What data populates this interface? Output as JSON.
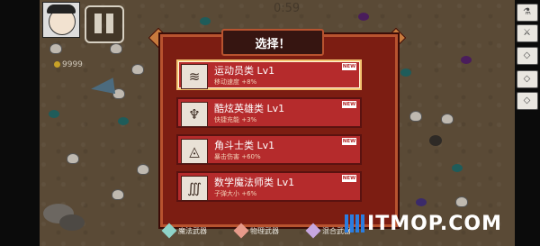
{
  "hud": {
    "timer": "0:59",
    "score": "9999",
    "pause_label": "pause"
  },
  "dialog": {
    "title": "选择！",
    "cards": [
      {
        "name": "运动员类 Lv1",
        "desc": "移动速度 +8%",
        "badge": "NEW",
        "icon": "runner-icon",
        "glyph": "≋"
      },
      {
        "name": "酷炫英雄类 Lv1",
        "desc": "快捷充能 +3%",
        "badge": "NEW",
        "icon": "hero-mask-icon",
        "glyph": "♆"
      },
      {
        "name": "角斗士类 Lv1",
        "desc": "暴击伤害 +60%",
        "badge": "NEW",
        "icon": "gladiator-helmet-icon",
        "glyph": "◬"
      },
      {
        "name": "数学魔法师类 Lv1",
        "desc": "子弹大小 +6%",
        "badge": "NEW",
        "icon": "math-wizard-icon",
        "glyph": "∭"
      }
    ]
  },
  "legend": [
    {
      "label": "魔法武器",
      "color": "#8fd3c8"
    },
    {
      "label": "物理武器",
      "color": "#e79a8a"
    },
    {
      "label": "混合武器",
      "color": "#c6a6e0"
    }
  ],
  "watermark": "ITMOP.COM",
  "colors": {
    "dialog_bg": "#7c1d12",
    "card_bg": "#b52b2c",
    "selected_border": "#f2c26f",
    "ground": "#5a4a36"
  }
}
